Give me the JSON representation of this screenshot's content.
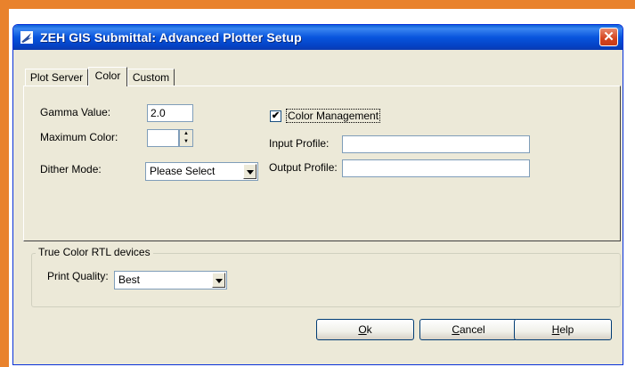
{
  "window": {
    "title": "ZEH GIS Submittal: Advanced Plotter Setup",
    "close_glyph": "✕"
  },
  "tabs": [
    {
      "label": "Plot Server",
      "active": false
    },
    {
      "label": "Color",
      "active": true
    },
    {
      "label": "Custom",
      "active": false
    }
  ],
  "color_tab": {
    "gamma_label": "Gamma Value:",
    "gamma_value": "2.0",
    "max_color_label": "Maximum Color:",
    "max_color_value": "",
    "dither_label": "Dither Mode:",
    "dither_value": "Please Select",
    "color_mgmt_label": "Color Management",
    "color_mgmt_checked": true,
    "check_glyph": "✔",
    "input_profile_label": "Input Profile:",
    "input_profile_value": "",
    "output_profile_label": "Output Profile:",
    "output_profile_value": ""
  },
  "rtl_group": {
    "title": "True Color RTL devices",
    "quality_label": "Print Quality:",
    "quality_value": "Best"
  },
  "buttons": {
    "ok": {
      "mnemonic": "O",
      "rest": "k"
    },
    "cancel": {
      "mnemonic": "C",
      "rest": "ancel"
    },
    "help": {
      "mnemonic": "H",
      "rest": "elp"
    }
  },
  "colors": {
    "frame_accent": "#e9822c",
    "titlebar": "#0855dd",
    "dialog_bg": "#ece9d8"
  }
}
